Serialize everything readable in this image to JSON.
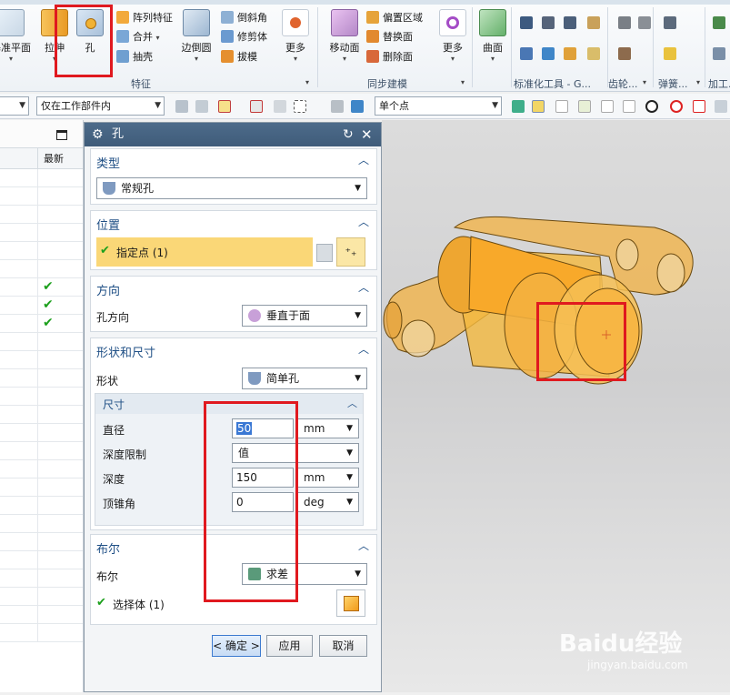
{
  "ribbon": {
    "items": {
      "datum_plane": "基准平面",
      "extrude": "拉伸",
      "hole": "孔",
      "pattern_feature": "阵列特征",
      "unite": "合并",
      "shell": "抽壳",
      "edge_blend": "边倒圆",
      "chamfer": "倒斜角",
      "trim_body": "修剪体",
      "draft": "拔模",
      "more_feature": "更多",
      "move_face": "移动面",
      "offset_region": "偏置区域",
      "replace_face": "替换面",
      "delete_face": "删除面",
      "more_sync": "更多",
      "surface": "曲面"
    },
    "groups": {
      "feature": "特征",
      "sync_modeling": "同步建模",
      "std_tools": "标准化工具 - G...",
      "gear": "齿轮...",
      "spring": "弹簧...",
      "machining": "加工..."
    }
  },
  "toolbar": {
    "filter_left": "",
    "scope": "仅在工作部件内",
    "snap_mode": "单个点"
  },
  "navigator": {
    "latest_col": "最新",
    "rows": [
      false,
      false,
      false,
      false,
      false,
      false,
      true,
      true,
      true,
      false,
      false,
      false,
      false,
      false,
      false,
      false,
      false,
      false,
      false,
      false,
      false,
      false,
      false,
      false,
      false,
      false
    ]
  },
  "dialog": {
    "title": "孔",
    "type": {
      "header": "类型",
      "value": "常规孔"
    },
    "position": {
      "header": "位置",
      "specify_point": "指定点 (1)"
    },
    "direction": {
      "header": "方向",
      "label": "孔方向",
      "value": "垂直于面"
    },
    "form": {
      "header": "形状和尺寸",
      "shape_label": "形状",
      "shape_value": "简单孔",
      "dims_header": "尺寸",
      "diameter_label": "直径",
      "diameter_value": "50",
      "diameter_unit": "mm",
      "depth_limit_label": "深度限制",
      "depth_limit_value": "值",
      "depth_label": "深度",
      "depth_value": "150",
      "depth_unit": "mm",
      "tip_angle_label": "顶锥角",
      "tip_angle_value": "0",
      "tip_angle_unit": "deg"
    },
    "boolean": {
      "header": "布尔",
      "label": "布尔",
      "value": "求差",
      "select_body": "选择体 (1)"
    },
    "buttons": {
      "ok": "< 确定 >",
      "apply": "应用",
      "cancel": "取消"
    }
  },
  "watermark": {
    "brand": "Baidu经验",
    "url": "jingyan.baidu.com"
  },
  "colors": {
    "section_header": "#1f4f85",
    "highlight_row": "#fad777",
    "title_bar": "#46637f",
    "annotation_red": "#e0191f",
    "model_orange": "#f3b141",
    "check_green": "#1da01d"
  }
}
